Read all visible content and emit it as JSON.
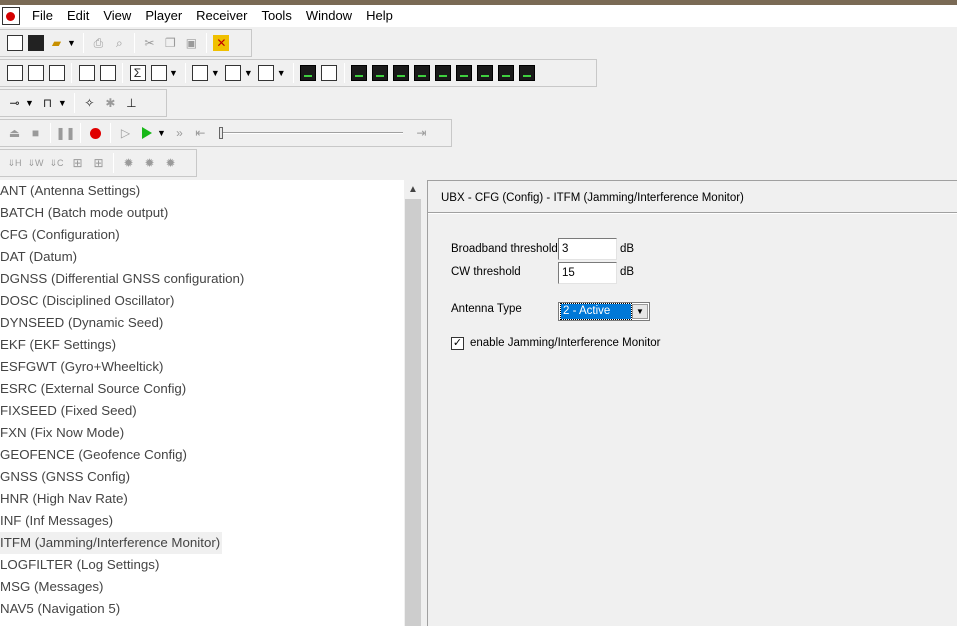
{
  "menubar": {
    "items": [
      "File",
      "Edit",
      "View",
      "Player",
      "Receiver",
      "Tools",
      "Window",
      "Help"
    ]
  },
  "toolbar5": {
    "labels": [
      "H",
      "W",
      "C"
    ]
  },
  "message_list": {
    "items": [
      "ANT (Antenna Settings)",
      "BATCH (Batch mode output)",
      "CFG (Configuration)",
      "DAT (Datum)",
      "DGNSS (Differential GNSS configuration)",
      "DOSC (Disciplined Oscillator)",
      "DYNSEED (Dynamic Seed)",
      "EKF (EKF Settings)",
      "ESFGWT (Gyro+Wheeltick)",
      "ESRC (External Source Config)",
      "FIXSEED (Fixed Seed)",
      "FXN (Fix Now Mode)",
      "GEOFENCE (Geofence Config)",
      "GNSS (GNSS Config)",
      "HNR (High Nav Rate)",
      "INF (Inf Messages)",
      "ITFM (Jamming/Interference Monitor)",
      "LOGFILTER (Log Settings)",
      "MSG (Messages)",
      "NAV5 (Navigation 5)"
    ],
    "selected": "ITFM (Jamming/Interference Monitor)"
  },
  "config_panel": {
    "title": "UBX - CFG (Config) - ITFM (Jamming/Interference Monitor)",
    "broadband_label": "Broadband threshold",
    "broadband_value": "3",
    "broadband_unit": "dB",
    "cw_label": "CW threshold",
    "cw_value": "15",
    "cw_unit": "dB",
    "antenna_label": "Antenna Type",
    "antenna_value": "2 - Active",
    "enable_label": "enable Jamming/Interference Monitor",
    "enable_checked": true
  }
}
